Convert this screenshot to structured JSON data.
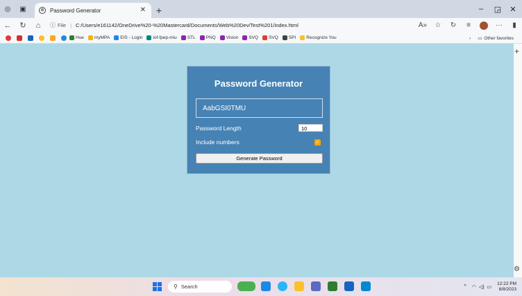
{
  "browser": {
    "tab_title": "Password Generator",
    "address": {
      "scheme_label": "File",
      "url": "C:/Users/e161142/OneDrive%20-%20Mastercard/Documents/Web%20Dev/Test%201/index.html"
    },
    "favorites": [
      {
        "label": "Hue",
        "color": "#2e7d32"
      },
      {
        "label": "myMPA",
        "color": "#f4b400"
      },
      {
        "label": "EIS - Login",
        "color": "#1e88e5"
      },
      {
        "label": "iof-fpep-miu",
        "color": "#00897b"
      },
      {
        "label": "STL",
        "color": "#8e24aa"
      },
      {
        "label": "PNQ",
        "color": "#8e24aa"
      },
      {
        "label": "Vision",
        "color": "#8e24aa"
      },
      {
        "label": "SVQ",
        "color": "#8e24aa"
      },
      {
        "label": "SVQ",
        "color": "#e53935"
      },
      {
        "label": "SPI",
        "color": "#37474f"
      },
      {
        "label": "Recognize You",
        "color": "#fbc02d"
      }
    ],
    "other_favorites": "Other favorites"
  },
  "app": {
    "title": "Password Generator",
    "password": "AabGSI0TMU",
    "length_label": "Password Length",
    "length_value": "10",
    "numbers_label": "Include numbers",
    "numbers_checked": true,
    "generate_label": "Generate Password",
    "colors": {
      "background": "#add8e6",
      "card": "#4682b4",
      "checkbox": "#ffa500"
    }
  },
  "taskbar": {
    "search_label": "Search",
    "time": "12:22 PM",
    "date": "6/8/2023"
  }
}
